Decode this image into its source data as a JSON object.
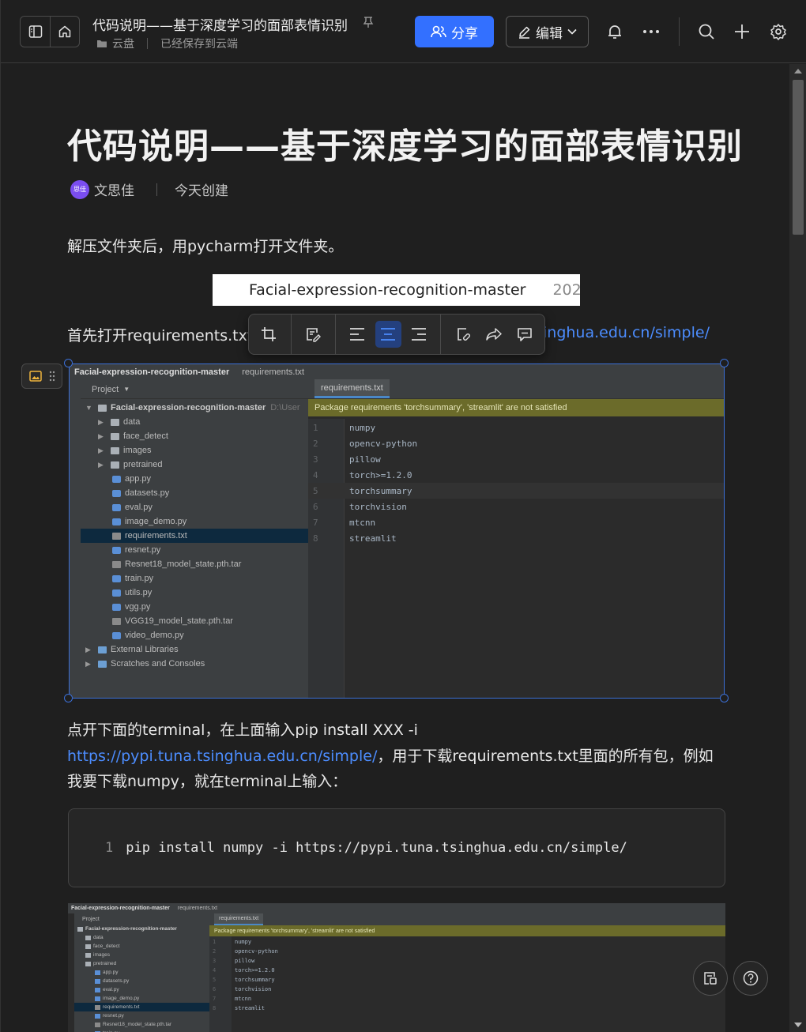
{
  "header": {
    "doc_title": "代码说明——基于深度学习的面部表情识别",
    "breadcrumb_location": "云盘",
    "save_status": "已经保存到云端",
    "share_label": "分享",
    "edit_label": "编辑",
    "accent_color": "#3370ff"
  },
  "doc": {
    "title": "代码说明——基于深度学习的面部表情识别",
    "author_avatar_text": "思佳",
    "author": "文思佳",
    "created": "今天创建",
    "para1": "解压文件夹后，用pycharm打开文件夹。",
    "banner_name": "Facial-expression-recognition-master",
    "banner_year": "202",
    "para2_text": "首先打开requirements.txt",
    "para2_link": "inghua.edu.cn/simple/",
    "para3_line1": "点开下面的terminal，在上面输入pip install XXX -i",
    "para3_link": "https://pypi.tuna.tsinghua.edu.cn/simple/",
    "para3_line2_rest": "，用于下载requirements.txt里面的所有包，例如",
    "para3_line3": "我要下载numpy，就在terminal上输入：",
    "code_line_no": "1",
    "code_line": "pip install numpy -i https://pypi.tuna.tsinghua.edu.cn/simple/"
  },
  "ide": {
    "path_project": "Facial-expression-recognition-master",
    "path_file": "requirements.txt",
    "vertical_tab": "Project",
    "project_label": "Project",
    "root_folder": "Facial-expression-recognition-master",
    "root_path": "D:\\User",
    "tree": [
      {
        "name": "data",
        "type": "dir"
      },
      {
        "name": "face_detect",
        "type": "dir"
      },
      {
        "name": "images",
        "type": "dir"
      },
      {
        "name": "pretrained",
        "type": "dir"
      },
      {
        "name": "app.py",
        "type": "py"
      },
      {
        "name": "datasets.py",
        "type": "py"
      },
      {
        "name": "eval.py",
        "type": "py"
      },
      {
        "name": "image_demo.py",
        "type": "py"
      },
      {
        "name": "requirements.txt",
        "type": "txt"
      },
      {
        "name": "resnet.py",
        "type": "py"
      },
      {
        "name": "Resnet18_model_state.pth.tar",
        "type": "txt"
      },
      {
        "name": "train.py",
        "type": "py"
      },
      {
        "name": "utils.py",
        "type": "py"
      },
      {
        "name": "vgg.py",
        "type": "py"
      },
      {
        "name": "VGG19_model_state.pth.tar",
        "type": "txt"
      },
      {
        "name": "video_demo.py",
        "type": "py"
      }
    ],
    "external_libraries": "External Libraries",
    "scratches": "Scratches and Consoles",
    "editor_tab": "requirements.txt",
    "warning": "Package requirements 'torchsummary', 'streamlit' are not satisfied",
    "code_lines": [
      {
        "n": "1",
        "t": "numpy"
      },
      {
        "n": "2",
        "t": "opencv-python"
      },
      {
        "n": "3",
        "t": "pillow"
      },
      {
        "n": "4",
        "t": "torch>=1.2.0"
      },
      {
        "n": "5",
        "t": "torchsummary"
      },
      {
        "n": "6",
        "t": "torchvision"
      },
      {
        "n": "7",
        "t": "mtcnn"
      },
      {
        "n": "8",
        "t": "streamlit"
      }
    ]
  },
  "ide2": {
    "tree": [
      {
        "name": "data",
        "type": "dir"
      },
      {
        "name": "face_detect",
        "type": "dir"
      },
      {
        "name": "images",
        "type": "dir"
      },
      {
        "name": "pretrained",
        "type": "dir"
      },
      {
        "name": "app.py",
        "type": "py"
      },
      {
        "name": "datasets.py",
        "type": "py"
      },
      {
        "name": "eval.py",
        "type": "py"
      },
      {
        "name": "image_demo.py",
        "type": "py"
      },
      {
        "name": "requirements.txt",
        "type": "txt"
      },
      {
        "name": "resnet.py",
        "type": "py"
      },
      {
        "name": "Resnet18_model_state.pth.tar",
        "type": "txt"
      },
      {
        "name": "train.py",
        "type": "py"
      }
    ],
    "code_lines": [
      {
        "n": "1",
        "t": "numpy"
      },
      {
        "n": "2",
        "t": "opencv-python"
      },
      {
        "n": "3",
        "t": "pillow"
      },
      {
        "n": "4",
        "t": "torch>=1.2.0"
      },
      {
        "n": "5",
        "t": "torchsummary"
      },
      {
        "n": "6",
        "t": "torchvision"
      },
      {
        "n": "7",
        "t": "mtcnn"
      },
      {
        "n": "8",
        "t": "streamlit"
      }
    ]
  }
}
